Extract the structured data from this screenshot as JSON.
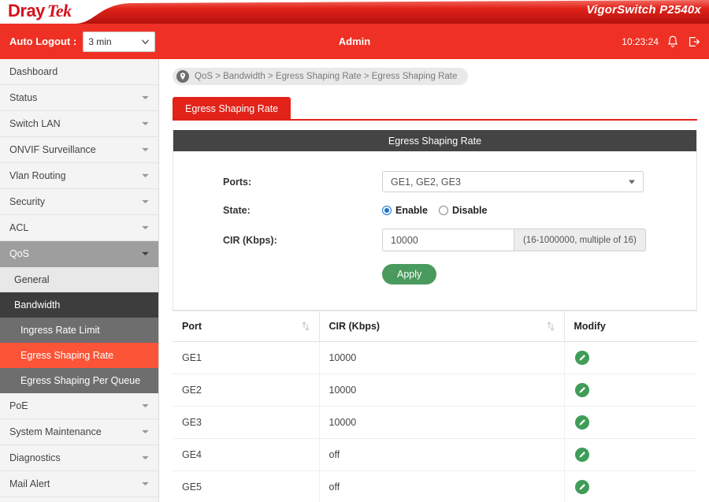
{
  "header": {
    "logo_dray": "Dray",
    "logo_tek": "Tek",
    "model": "VigorSwitch P2540x"
  },
  "adminbar": {
    "auto_logout_label": "Auto Logout :",
    "auto_logout_value": "3 min",
    "auto_logout_options": [
      "3 min"
    ],
    "admin_label": "Admin",
    "time": "10:23:24",
    "bell_icon": "bell-icon",
    "logout_icon": "logout-icon"
  },
  "sidebar": {
    "items": [
      {
        "label": "Dashboard",
        "expandable": false,
        "state": "normal"
      },
      {
        "label": "Status",
        "expandable": true,
        "state": "normal"
      },
      {
        "label": "Switch LAN",
        "expandable": true,
        "state": "normal"
      },
      {
        "label": "ONVIF Surveillance",
        "expandable": true,
        "state": "normal"
      },
      {
        "label": "Vlan Routing",
        "expandable": true,
        "state": "normal"
      },
      {
        "label": "Security",
        "expandable": true,
        "state": "normal"
      },
      {
        "label": "ACL",
        "expandable": true,
        "state": "normal"
      },
      {
        "label": "QoS",
        "expandable": true,
        "state": "active-group"
      }
    ],
    "qos_children": [
      {
        "label": "General",
        "state": "sub"
      },
      {
        "label": "Bandwidth",
        "state": "sub-dark"
      }
    ],
    "bandwidth_children": [
      {
        "label": "Ingress Rate Limit",
        "state": "sub2"
      },
      {
        "label": "Egress Shaping Rate",
        "state": "sub2-selected"
      },
      {
        "label": "Egress Shaping Per Queue",
        "state": "sub2"
      }
    ],
    "items_after": [
      {
        "label": "PoE",
        "expandable": true
      },
      {
        "label": "System Maintenance",
        "expandable": true
      },
      {
        "label": "Diagnostics",
        "expandable": true
      },
      {
        "label": "Mail Alert",
        "expandable": true
      }
    ]
  },
  "breadcrumb": {
    "pin_icon": "location-pin-icon",
    "text": "QoS > Bandwidth > Egress Shaping Rate  >  Egress Shaping Rate"
  },
  "tab": {
    "label": "Egress Shaping Rate"
  },
  "panel": {
    "title": "Egress Shaping Rate",
    "ports_label": "Ports:",
    "ports_value": "GE1, GE2, GE3",
    "ports_options": [
      "GE1, GE2, GE3"
    ],
    "state_label": "State:",
    "state_enable": "Enable",
    "state_disable": "Disable",
    "state_selected": "Enable",
    "cir_label": "CIR (Kbps):",
    "cir_value": "10000",
    "cir_hint": "(16-1000000, multiple of 16)",
    "apply_label": "Apply"
  },
  "table": {
    "columns": [
      "Port",
      "CIR (Kbps)",
      "Modify"
    ],
    "rows": [
      {
        "port": "GE1",
        "cir": "10000",
        "modify_icon": "edit-pencil-icon"
      },
      {
        "port": "GE2",
        "cir": "10000",
        "modify_icon": "edit-pencil-icon"
      },
      {
        "port": "GE3",
        "cir": "10000",
        "modify_icon": "edit-pencil-icon"
      },
      {
        "port": "GE4",
        "cir": "off",
        "modify_icon": "edit-pencil-icon"
      },
      {
        "port": "GE5",
        "cir": "off",
        "modify_icon": "edit-pencil-icon"
      }
    ]
  },
  "colors": {
    "brand_red": "#ee3124",
    "tab_red": "#e2231a",
    "selected_orange": "#fb5436",
    "panel_dark": "#444444",
    "apply_green": "#4a9a5e",
    "radio_blue": "#1a6fd4"
  }
}
